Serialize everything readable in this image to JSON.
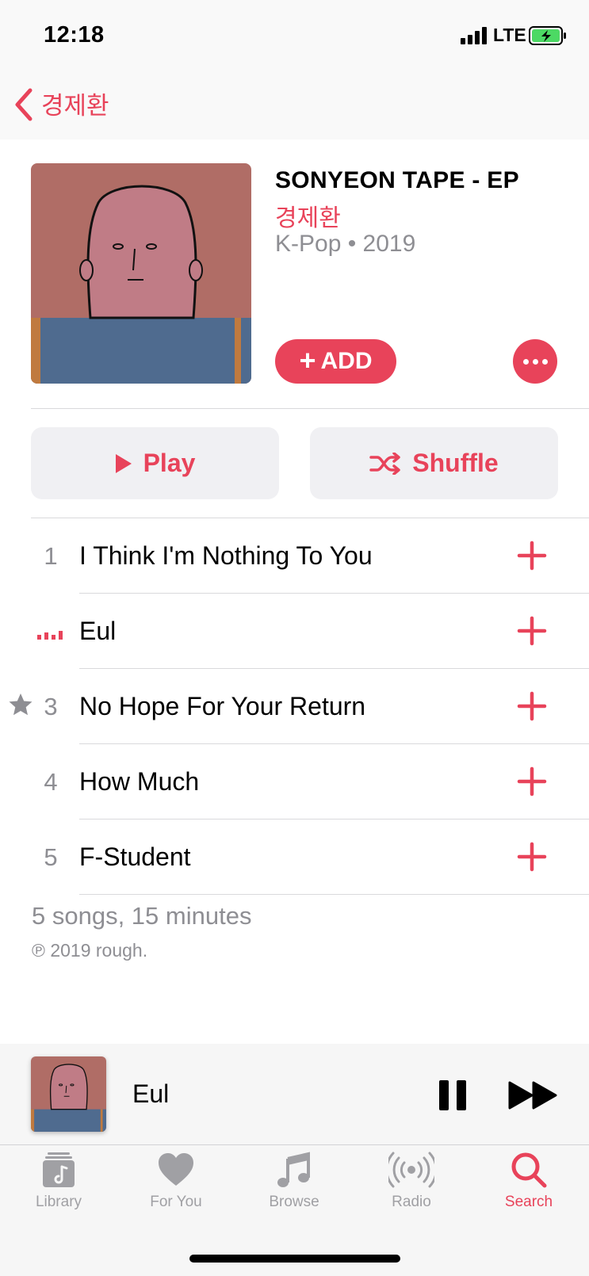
{
  "status_bar": {
    "time": "12:18",
    "network": "LTE"
  },
  "nav": {
    "back_label": "경제환"
  },
  "album": {
    "title": "SONYEON TAPE - EP",
    "artist": "경제환",
    "meta": "K-Pop • 2019",
    "add_label": "ADD"
  },
  "actions": {
    "play_label": "Play",
    "shuffle_label": "Shuffle"
  },
  "tracks": [
    {
      "number": "1",
      "title": "I Think I'm Nothing To You",
      "playing": false,
      "starred": false
    },
    {
      "number": "",
      "title": "Eul",
      "playing": true,
      "starred": false
    },
    {
      "number": "3",
      "title": "No Hope For Your Return",
      "playing": false,
      "starred": true
    },
    {
      "number": "4",
      "title": "How Much",
      "playing": false,
      "starred": false
    },
    {
      "number": "5",
      "title": "F-Student",
      "playing": false,
      "starred": false
    }
  ],
  "footer": {
    "summary": "5 songs, 15 minutes",
    "copyright": "℗ 2019 rough."
  },
  "mini_player": {
    "title": "Eul"
  },
  "tabs": [
    {
      "label": "Library",
      "icon": "library-icon",
      "active": false
    },
    {
      "label": "For You",
      "icon": "heart-icon",
      "active": false
    },
    {
      "label": "Browse",
      "icon": "music-note-icon",
      "active": false
    },
    {
      "label": "Radio",
      "icon": "radio-icon",
      "active": false
    },
    {
      "label": "Search",
      "icon": "search-icon",
      "active": true
    }
  ],
  "colors": {
    "accent": "#e8435a",
    "secondary_text": "#8e8e93",
    "tab_inactive": "#a0a0a4"
  }
}
